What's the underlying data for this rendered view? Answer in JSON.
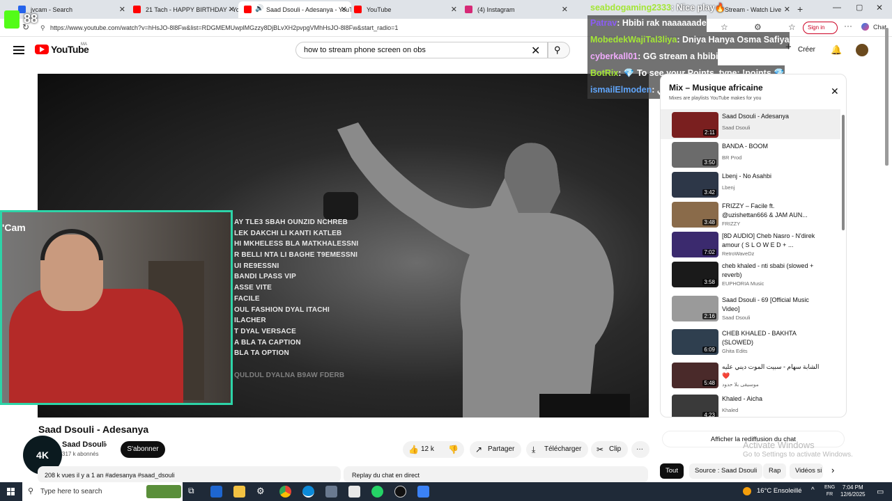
{
  "browser": {
    "tabs": [
      {
        "label": "jvcam - Search",
        "color": "#2563eb"
      },
      {
        "label": "21 Tach - HAPPY BIRTHDAY - YouT",
        "color": "#ff0000"
      },
      {
        "label": "Saad Dsouli - Adesanya - YouT",
        "color": "#ff0000"
      },
      {
        "label": "YouTube",
        "color": "#ff0000"
      },
      {
        "label": "(4) Instagram",
        "color": "#d62976"
      },
      {
        "label": "Stream - Watch Live",
        "color": "#53fc18"
      }
    ],
    "url": "https://www.youtube.com/watch?v=hHsJO-8l8Fw&list=RDGMEMUwplMGzzy8DjBLvXH2pvpgVMhHsJO-8l8Fw&start_radio=1",
    "sign_in": "Sign in",
    "chat_btn": "Chat"
  },
  "stream_overlay": {
    "viewer_count": "88",
    "cam_label": "'Cam",
    "chat": [
      {
        "user": "seabdogaming2333",
        "msg": ": Nice play🔥"
      },
      {
        "user": "Patrav",
        "msg": ": Hbibi rak naaaaaade"
      },
      {
        "user": "MobedekWajiTal3liya",
        "msg": ": Dniya Hanya Osma Safiya"
      },
      {
        "user": "cyberkall01",
        "msg": ": GG stream a hbibi"
      },
      {
        "user": "BotRix",
        "msg": ": 💎 To see your Points, type: !points 💎"
      },
      {
        "user": "ismailElmoden",
        "msg": ": محارب الله ولكني"
      }
    ]
  },
  "youtube": {
    "logo": "YouTube",
    "country": "MA",
    "search_value": "how to stream phone screen on obs",
    "create_label": "Créer",
    "lyrics": [
      "AY TLE3 SBAH OUNZID NCHREB",
      "LEK DAKCHI LI KANTI KATLEB",
      "HI MKHELESS BLA MATKHALESSNI",
      "R BELLI NTA LI BAGHE T9EMESSNI",
      "UI RE9ESSNI",
      "BANDI LPASS VIP",
      "ASSE VITE",
      "FACILE",
      "OUL FASHION DYAL ITACHI",
      "ILACHER",
      "T DYAL VERSACE",
      "A BLA TA CAPTION",
      "BLA TA OPTION",
      "",
      "QULDUL DYALNA B9AW FDERB"
    ],
    "video_title": "Saad Dsouli - Adesanya",
    "channel": {
      "name": "Saad Dsouli",
      "subscribers": "317 k abonnés",
      "avatar_text": "4K"
    },
    "subscribe_label": "S'abonner",
    "actions": {
      "likes": "12 k",
      "share": "Partager",
      "download": "Télécharger",
      "clip": "Clip"
    },
    "description": "208 k vues  il y a 1 an  #adesanya #saad_dsouli",
    "replay_chat": "Replay du chat en direct",
    "replay_button": "Afficher la rediffusion du chat",
    "playlist": {
      "title": "Mix – Musique africaine",
      "subtitle": "Mixes are playlists YouTube makes for you",
      "items": [
        {
          "title": "Saad Dsouli - Adesanya",
          "artist": "Saad Dsouli",
          "duration": "2:11",
          "color": "#7a1f1f"
        },
        {
          "title": "BANDA - BOOM",
          "artist": "BR Prod",
          "duration": "3:50",
          "color": "#6b6b6b"
        },
        {
          "title": "Lbenj - No Asahbi",
          "artist": "Lbenj",
          "duration": "3:42",
          "color": "#2d3748"
        },
        {
          "title": "FRIZZY – Facile ft. @uzishettan666 & JAM AUN...",
          "artist": "FRIZZY",
          "duration": "3:48",
          "color": "#8a6b4a"
        },
        {
          "title": "[8D AUDIO] Cheb Nasro - N'direk amour ( S L O W E D + ...",
          "artist": "RetroWaveDz",
          "duration": "7:02",
          "color": "#3b2a6e"
        },
        {
          "title": "cheb khaled - nti sbabi (slowed + reverb)",
          "artist": "EUPHORIA Music",
          "duration": "3:58",
          "color": "#1a1a1a"
        },
        {
          "title": "Saad Dsouli - 69 [Official Music Video]",
          "artist": "Saad Dsouli",
          "duration": "2:16",
          "color": "#9a9a9a"
        },
        {
          "title": "CHEB KHALED - BAKHTA (SLOWED)",
          "artist": "Ghita Edits",
          "duration": "6:09",
          "color": "#2f3f4f"
        },
        {
          "title": "الشابة سهام - سبيت الموت ديني عليه ❤️",
          "artist": "موسيقى بلا حدود",
          "duration": "5:48",
          "color": "#4a2a2a"
        },
        {
          "title": "Khaled - Aicha",
          "artist": "Khaled",
          "duration": "4:23",
          "color": "#3a3a3a"
        }
      ]
    },
    "chips": [
      "Tout",
      "Source : Saad Dsouli",
      "Rap",
      "Vidéos si"
    ]
  },
  "windows": {
    "activate_title": "Activate Windows",
    "activate_sub": "Go to Settings to activate Windows.",
    "search_placeholder": "Type here to search",
    "weather": "16°C  Ensoleillé",
    "lang_top": "ENG",
    "lang_bottom": "FR",
    "time": "7:04 PM",
    "date": "12/6/2025"
  }
}
